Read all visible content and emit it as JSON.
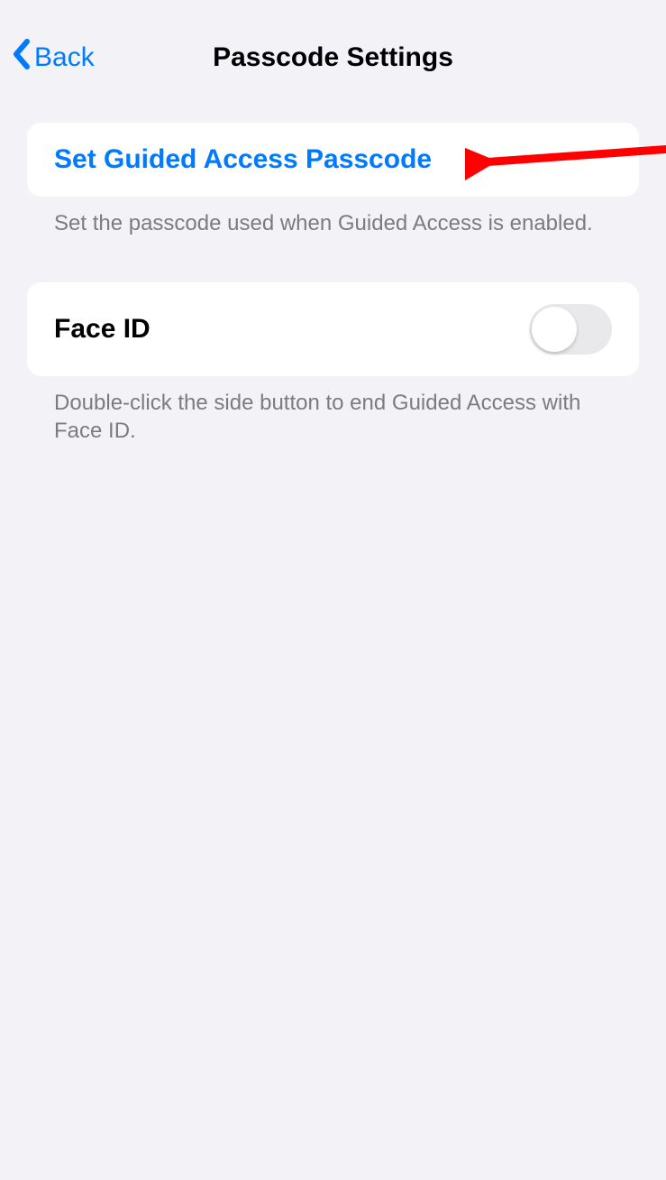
{
  "header": {
    "back_label": "Back",
    "title": "Passcode Settings"
  },
  "section1": {
    "link_label": "Set Guided Access Passcode",
    "footer": "Set the passcode used when Guided Access is enabled."
  },
  "section2": {
    "label": "Face ID",
    "toggle_on": false,
    "footer": "Double-click the side button to end Guided Access with Face ID."
  },
  "annotation": {
    "arrow_color": "#ff0000"
  }
}
